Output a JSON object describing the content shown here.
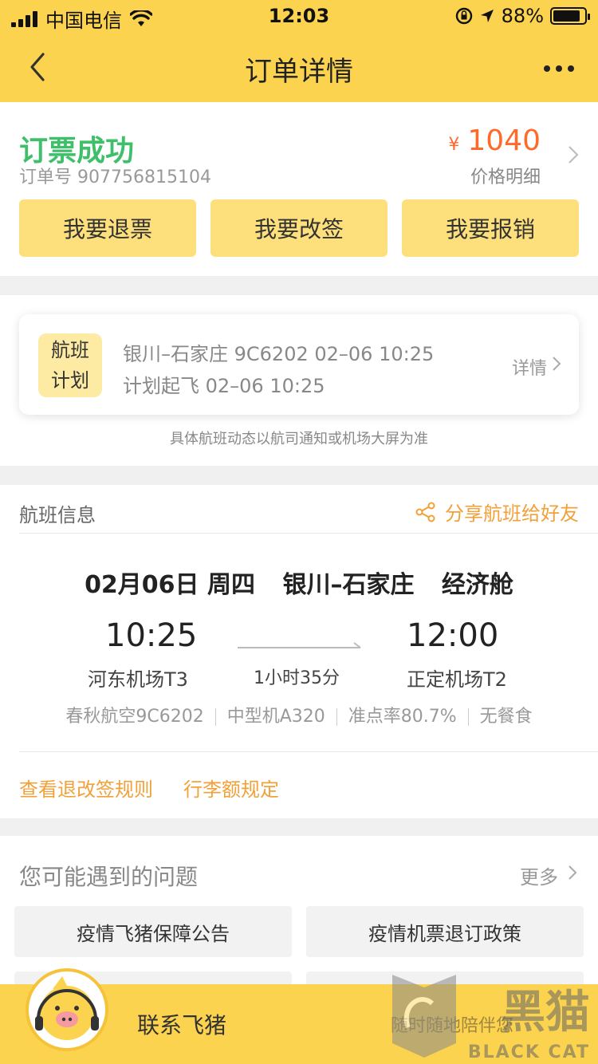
{
  "status_bar": {
    "carrier": "中国电信",
    "time": "12:03",
    "battery": "88%"
  },
  "nav": {
    "title": "订单详情"
  },
  "order": {
    "status": "订票成功",
    "order_no": "订单号 907756815104",
    "currency": "¥",
    "price": "1040",
    "price_detail": "价格明细",
    "actions": [
      "我要退票",
      "我要改签",
      "我要报销"
    ]
  },
  "flight_plan": {
    "badge_line1": "航班",
    "badge_line2": "计划",
    "line1": "银川–石家庄 9C6202 02–06 10:25",
    "line2": "计划起飞 02–06 10:25",
    "detail": "详情",
    "note": "具体航班动态以航司通知或机场大屏为准"
  },
  "flight_info": {
    "title": "航班信息",
    "share": "分享航班给好友",
    "date": "02月06日 周四",
    "route": "银川–石家庄",
    "cabin": "经济舱",
    "dep_time": "10:25",
    "arr_time": "12:00",
    "dep_airport": "河东机场T3",
    "arr_airport": "正定机场T2",
    "duration": "1小时35分",
    "airline": "春秋航空9C6202",
    "aircraft": "中型机A320",
    "on_time": "准点率80.7%",
    "meal": "无餐食",
    "link_rules": "查看退改签规则",
    "link_baggage": "行李额规定"
  },
  "questions": {
    "title": "您可能遇到的问题",
    "more": "更多",
    "items": [
      "疫情飞猪保障公告",
      "疫情机票退订政策"
    ]
  },
  "contact": {
    "label": "联系飞猪",
    "sub": "随时随地陪伴您"
  },
  "watermark": {
    "big": "黑猫",
    "small": "BLACK CAT"
  },
  "colors": {
    "brand_yellow": "#fbd34f",
    "button_yellow": "#fde07c",
    "success_green": "#3fbf6a",
    "price_orange": "#ff6a2a",
    "link_orange": "#f2a13a"
  }
}
